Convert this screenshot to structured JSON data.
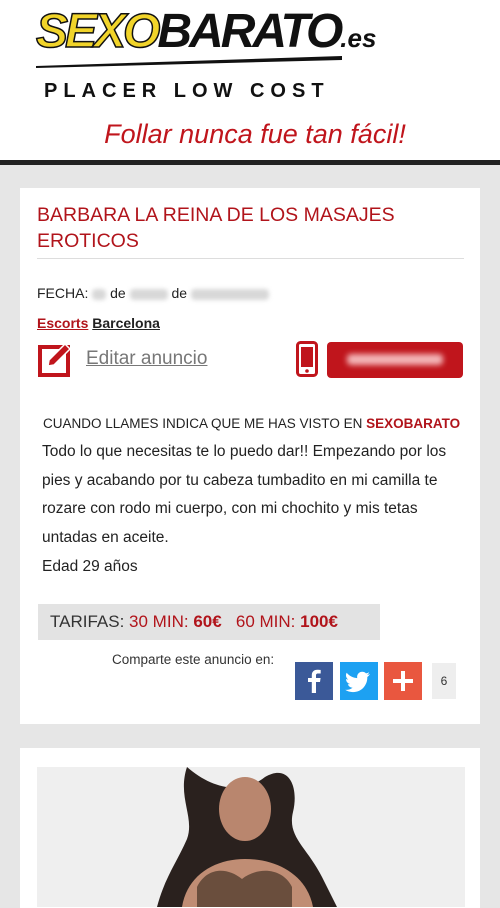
{
  "header": {
    "logo": {
      "part1": "SEXO",
      "part2": "BARATO",
      "part3": ".es"
    },
    "tagline": "PLACER LOW COST",
    "slogan": "Follar nunca fue tan fácil!"
  },
  "listing": {
    "title": "BARBARA LA REINA DE LOS MASAJES EROTICOS",
    "date_label": "FECHA:",
    "date_de1": "de",
    "date_de2": "de",
    "category_link": "Escorts",
    "city_link": "Barcelona",
    "edit_label": "Editar anuncio",
    "call_note_prefix": "CUANDO LLAMES INDICA QUE ME HAS VISTO EN",
    "call_note_brand": "SEXOBARATO",
    "description": "Todo lo que necesitas te lo puedo dar!! Empezando por los pies y acabando por tu cabeza tumbadito en mi camilla te rozare con rodo mi cuerpo, con mi chochito y mis tetas untadas en aceite.",
    "age": "Edad 29 años",
    "rates": {
      "label": "TARIFAS:",
      "r1_time": "30 MIN:",
      "r1_price": "60€",
      "r2_time": "60 MIN:",
      "r2_price": "100€"
    },
    "share_label": "Comparte este anuncio en:",
    "share_count": "6"
  },
  "colors": {
    "accent_red": "#c0151c",
    "facebook": "#3b5998",
    "twitter": "#1da1f2",
    "gplus": "#e9573f"
  },
  "icons": [
    "edit-icon",
    "phone-icon",
    "facebook-icon",
    "twitter-icon",
    "plus-icon"
  ]
}
